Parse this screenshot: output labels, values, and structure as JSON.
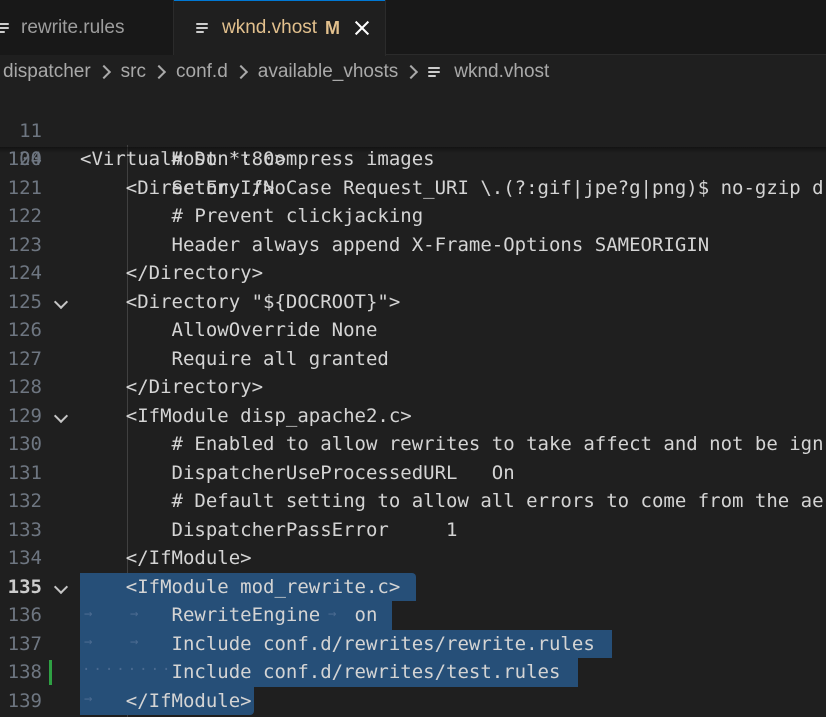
{
  "tabs": [
    {
      "label": "rewrite.rules",
      "active": false
    },
    {
      "label": "wknd.vhost",
      "active": true,
      "status": "M"
    }
  ],
  "breadcrumb": [
    "dispatcher",
    "src",
    "conf.d",
    "available_vhosts",
    "wknd.vhost"
  ],
  "sticky_lines": [
    {
      "number": "11",
      "text": "<VirtualHost *:80>"
    },
    {
      "number": "104",
      "text": "    <Directory />"
    }
  ],
  "lines": [
    {
      "number": "120",
      "text": "        # Don't compress images"
    },
    {
      "number": "121",
      "text": "        SetEnvIfNoCase Request_URI \\.(?:gif|jpe?g|png)$ no-gzip d"
    },
    {
      "number": "122",
      "text": "        # Prevent clickjacking"
    },
    {
      "number": "123",
      "text": "        Header always append X-Frame-Options SAMEORIGIN"
    },
    {
      "number": "124",
      "text": "    </Directory>"
    },
    {
      "number": "125",
      "text": "    <Directory \"${DOCROOT}\">"
    },
    {
      "number": "126",
      "text": "        AllowOverride None"
    },
    {
      "number": "127",
      "text": "        Require all granted"
    },
    {
      "number": "128",
      "text": "    </Directory>"
    },
    {
      "number": "129",
      "text": "    <IfModule disp_apache2.c>"
    },
    {
      "number": "130",
      "text": "        # Enabled to allow rewrites to take affect and not be ign"
    },
    {
      "number": "131",
      "text": "        DispatcherUseProcessedURL   On"
    },
    {
      "number": "132",
      "text": "        # Default setting to allow all errors to come from the ae"
    },
    {
      "number": "133",
      "text": "        DispatcherPassError     1"
    },
    {
      "number": "134",
      "text": "    </IfModule>"
    },
    {
      "number": "135",
      "text": "    <IfModule mod_rewrite.c>"
    },
    {
      "number": "136",
      "text": "        RewriteEngine   on"
    },
    {
      "number": "137",
      "text": "        Include conf.d/rewrites/rewrite.rules"
    },
    {
      "number": "138",
      "text": "        Include conf.d/rewrites/test.rules"
    },
    {
      "number": "139",
      "text": "    </IfModule>"
    }
  ],
  "folded_lines": [
    "125",
    "129",
    "135"
  ],
  "current_line": "135",
  "git_modified_line": "138",
  "colors": {
    "selection": "#264f78",
    "modified_tab": "#e2c08d",
    "git_added": "#2ea043",
    "background": "#1f1f1f"
  }
}
